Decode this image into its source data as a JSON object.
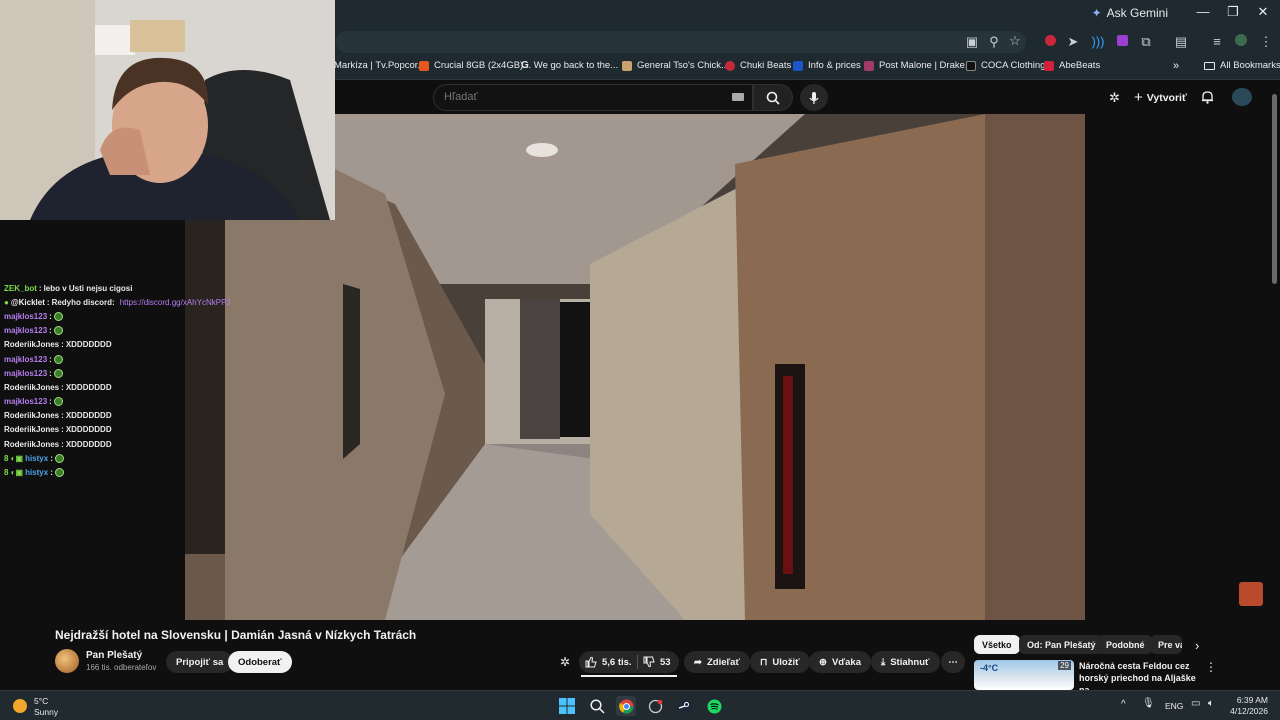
{
  "browser": {
    "ask_gemini": "Ask Gemini",
    "window_controls": [
      "—",
      "❐",
      "✕"
    ],
    "bookmarks": [
      {
        "label": "Markíza | Tv.Popcor...",
        "color": "#1f2a30"
      },
      {
        "label": "Crucial 8GB (2x4GB)...",
        "color": "#e8551f"
      },
      {
        "label": "We go back to the...",
        "color": "#ffffff"
      },
      {
        "label": "General Tso's Chick...",
        "color": "#c9a36b"
      },
      {
        "label": "Chuki Beats",
        "color": "#c8283a"
      },
      {
        "label": "Info & prices",
        "color": "#1a56c9"
      },
      {
        "label": "Post Malone | Drake...",
        "color": "#a43a6a"
      },
      {
        "label": "COCA Clothing",
        "color": "#111111"
      },
      {
        "label": "AbeBeats",
        "color": "#d21f3c"
      }
    ],
    "all_bookmarks": "All Bookmarks"
  },
  "youtube": {
    "search_placeholder": "Hľadať",
    "create_label": "Vytvoriť",
    "video_title": "Nejdražší hotel na Slovensku | Damián Jasná v Nízkych Tatrách",
    "channel_name": "Pan Plešatý",
    "channel_subs": "166 tis. odberateľov",
    "join_label": "Pripojiť sa",
    "subscribe_label": "Odoberať",
    "likes": "5,6 tis.",
    "dislikes": "53",
    "share_label": "Zdieľať",
    "save_label": "Uložiť",
    "thanks_label": "Vďaka",
    "download_label": "Stiahnuť",
    "chips": [
      "Všetko",
      "Od: Pan Plešatý",
      "Podobné",
      "Pre vás"
    ],
    "rec_title": "Náročná cesta Feldou cez horský priechod na Aljaške na ...",
    "rec_badge": "29"
  },
  "chat": [
    {
      "user": "ZEK_bot",
      "text": "lebo v Usti nejsu cigosi",
      "color": "#7ddc4a",
      "prefix": "",
      "emote": false
    },
    {
      "user": "@Kicklet",
      "text": "Redyho discord:",
      "link": "https://discord.gg/xAhYcNkPPJ",
      "color": "#f1f1f1",
      "prefix": "●",
      "emote": false
    },
    {
      "user": "majklos123",
      "text": "",
      "color": "#b77ef2",
      "prefix": "",
      "emote": true
    },
    {
      "user": "majklos123",
      "text": "",
      "color": "#b77ef2",
      "prefix": "",
      "emote": true
    },
    {
      "user": "RoderiikJones",
      "text": "XDDDDDDD",
      "color": "#e9e9e9",
      "prefix": "",
      "emote": false
    },
    {
      "user": "majklos123",
      "text": "",
      "color": "#b77ef2",
      "prefix": "",
      "emote": true
    },
    {
      "user": "majklos123",
      "text": "",
      "color": "#b77ef2",
      "prefix": "",
      "emote": true
    },
    {
      "user": "RoderiikJones",
      "text": "XDDDDDDD",
      "color": "#e9e9e9",
      "prefix": "",
      "emote": false
    },
    {
      "user": "majklos123",
      "text": "",
      "color": "#b77ef2",
      "prefix": "",
      "emote": true
    },
    {
      "user": "RoderiikJones",
      "text": "XDDDDDDD",
      "color": "#e9e9e9",
      "prefix": "",
      "emote": false
    },
    {
      "user": "RoderiikJones",
      "text": "XDDDDDDD",
      "color": "#e9e9e9",
      "prefix": "",
      "emote": false
    },
    {
      "user": "RoderiikJones",
      "text": "XDDDDDDD",
      "color": "#e9e9e9",
      "prefix": "",
      "emote": false
    },
    {
      "user": "histyx",
      "text": "",
      "color": "#4aa3e8",
      "prefix": "8 ◐▣",
      "emote": true
    },
    {
      "user": "histyx",
      "text": "",
      "color": "#4aa3e8",
      "prefix": "8 ◐▣",
      "emote": true
    }
  ],
  "taskbar": {
    "temperature": "5°C",
    "weather": "Sunny",
    "language": "ENG",
    "time": "6:39 AM",
    "date": "4/12/2026"
  },
  "icons": [
    "search-icon",
    "mic-icon",
    "bell-icon",
    "create-plus-icon",
    "like-icon",
    "dislike-icon",
    "share-icon",
    "save-icon",
    "thanks-icon",
    "download-icon",
    "more-icon"
  ]
}
